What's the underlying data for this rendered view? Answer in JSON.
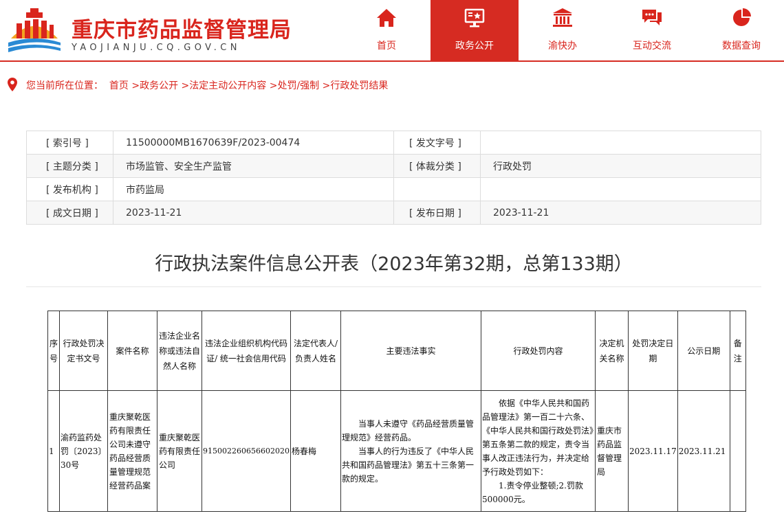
{
  "site": {
    "title": "重庆市药品监督管理局",
    "subtitle": "YAOJIANJU.CQ.GOV.CN",
    "brand_color": "#d9251d"
  },
  "nav": [
    {
      "label": "首页",
      "icon": "home-icon"
    },
    {
      "label": "政务公开",
      "icon": "monitor-star-icon",
      "active": true
    },
    {
      "label": "渝快办",
      "icon": "government-building-icon"
    },
    {
      "label": "互动交流",
      "icon": "chat-bubbles-icon"
    },
    {
      "label": "数据查询",
      "icon": "pie-chart-icon"
    }
  ],
  "breadcrumb": {
    "prefix": "您当前所在位置：",
    "items": [
      "首页",
      ">政务公开",
      ">法定主动公开内容",
      ">处罚/强制",
      ">行政处罚结果"
    ]
  },
  "meta": {
    "index_label": "[ 索引号 ]",
    "index_value": "11500000MB1670639F/2023-00474",
    "docno_label": "[ 发文字号 ]",
    "docno_value": "",
    "topic_label": "[ 主题分类 ]",
    "topic_value": "市场监管、安全生产监管",
    "genre_label": "[ 体裁分类 ]",
    "genre_value": "行政处罚",
    "org_label": "[ 发布机构 ]",
    "org_value": "市药监局",
    "made_label": "[ 成文日期 ]",
    "made_value": "2023-11-21",
    "pub_label": "[ 发布日期 ]",
    "pub_value": "2023-11-21"
  },
  "doc_title": "行政执法案件信息公开表（2023年第32期，总第133期）",
  "table": {
    "headers": {
      "no": "序号",
      "doc": "行政处罚决定书文号",
      "name": "案件名称",
      "company": "违法企业名称或违法自然人名称",
      "code": "违法企业组织机构代码证/ 统一社会信用代码",
      "rep": "法定代表人/负责人姓名",
      "fact": "主要违法事实",
      "penalty": "行政处罚内容",
      "org": "决定机关名称",
      "decide_date": "处罚决定日期",
      "publish_date": "公示日期",
      "note": "备注"
    },
    "row": {
      "no": "1",
      "doc": "渝药监药处罚〔2023〕30号",
      "name": "重庆聚乾医药有限责任公司未遵守药品经营质量管理规范经营药品案",
      "company": "重庆聚乾医药有限责任公司",
      "code": "915002260656602020",
      "rep": "杨春梅",
      "fact_1": "当事人未遵守《药品经营质量管理规范》经营药品。",
      "fact_2": "当事人的行为违反了《中华人民共和国药品管理法》第五十三条第一款的规定。",
      "penalty_1": "依据《中华人民共和国药品管理法》第一百二十六条、《中华人民共和国行政处罚法》第五条第二款的规定，责令当事人改正违法行为，并决定给予行政处罚如下：",
      "penalty_2": "1.责令停业整顿;2.罚款500000元。",
      "org": "重庆市药品监督管理局",
      "decide_date": "2023.11.17",
      "publish_date": "2023.11.21",
      "note": ""
    }
  }
}
